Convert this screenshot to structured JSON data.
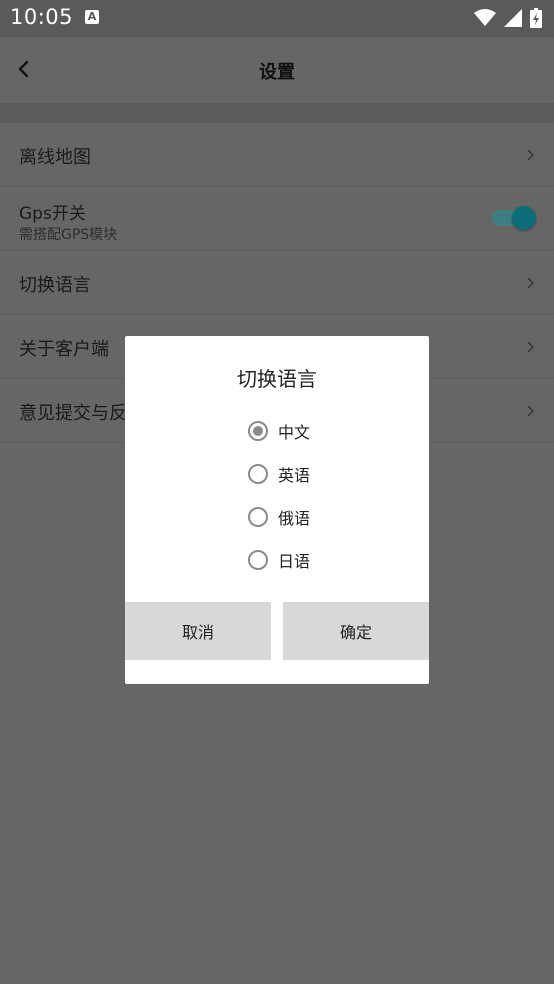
{
  "status": {
    "time": "10:05",
    "notif_letter": "A"
  },
  "appbar": {
    "title": "设置"
  },
  "settings": {
    "offline_map": "离线地图",
    "gps_title": "Gps开关",
    "gps_sub": "需搭配GPS模块",
    "language": "切换语言",
    "about": "关于客户端",
    "feedback": "意见提交与反馈"
  },
  "dialog": {
    "title": "切换语言",
    "options": [
      "中文",
      "英语",
      "俄语",
      "日语"
    ],
    "selected": "中文",
    "cancel": "取消",
    "ok": "确定"
  },
  "colors": {
    "toggle_accent": "#0b6d78"
  }
}
